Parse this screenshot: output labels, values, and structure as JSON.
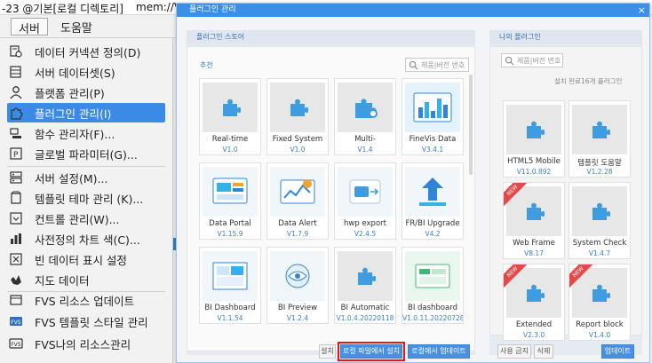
{
  "app": {
    "title_left": "-23 @기본[로컬 디렉토리]",
    "title_right": "mem://V"
  },
  "menubar": {
    "server": "서버",
    "help": "도움말"
  },
  "menu": {
    "items": [
      {
        "label": "데이터 커넥션 정의(D)",
        "icon": "data-connection-icon"
      },
      {
        "label": "서버 데이터셋(S)",
        "icon": "server-dataset-icon"
      },
      {
        "label": "플랫폼 관리(P)",
        "icon": "user-icon"
      },
      {
        "label": "플러그인 관리(I)",
        "icon": "puzzle-icon"
      },
      {
        "label": "함수 관리자(F)...",
        "icon": "function-icon"
      },
      {
        "label": "글로벌 파라미터(G)...",
        "icon": "parameter-icon"
      },
      {
        "label": "서버 설정(M)...",
        "icon": "server-settings-icon"
      },
      {
        "label": "템플릿 테마 관리 (K)...",
        "icon": "template-theme-icon"
      },
      {
        "label": "컨트롤 관리(W)...",
        "icon": "control-icon"
      },
      {
        "label": "사전정의 차트 색(C)...",
        "icon": "chart-color-icon"
      },
      {
        "label": "빈 데이터 표시 설정",
        "icon": "empty-data-icon"
      },
      {
        "label": "지도 데이터",
        "icon": "map-data-icon"
      },
      {
        "label": "FVS 리소스 업데이트",
        "icon": "fvs-update-icon"
      },
      {
        "label": "FVS 템플릿 스타일 관리",
        "icon": "fvs-template-icon"
      },
      {
        "label": "FVS나의 리소스관리",
        "icon": "fvs-resource-icon"
      }
    ]
  },
  "dialog": {
    "title": "플러그인 관리",
    "close": "×",
    "store": {
      "title": "플러그인 스토어",
      "section": "추천",
      "search_placeholder": "제품|버전 번호",
      "cards": [
        {
          "name": "Real-time",
          "version": "V1.0"
        },
        {
          "name": "Fixed System",
          "version": "V1.0"
        },
        {
          "name": "Multi-",
          "version": "V1.4"
        },
        {
          "name": "FineVis Data",
          "version": "V3.4.1"
        },
        {
          "name": "Data Portal",
          "version": "V1.15.9"
        },
        {
          "name": "Data Alert",
          "version": "V1.7.9"
        },
        {
          "name": "hwp export",
          "version": "V2.4.5"
        },
        {
          "name": "FR/BI Upgrade",
          "version": "V4.2"
        },
        {
          "name": "BI Dashboard",
          "version": "V1.1.54"
        },
        {
          "name": "BI Preview",
          "version": "V1.2.4"
        },
        {
          "name": "BI Automatic",
          "version": "V1.0.4.20220118"
        },
        {
          "name": "BI dashboard",
          "version": "V1.0.11.20220728"
        }
      ],
      "buttons": {
        "install": "설치",
        "install_local": "로컬 파일에서 설치",
        "update_local": "로컬에서 업데이트"
      }
    },
    "mine": {
      "title": "나의 플러그인",
      "search_placeholder": "제품|버전 번호",
      "count": "설치 완료16개 플러그인",
      "new_badge": "NEW",
      "cards": [
        {
          "name": "HTML5 Mobile",
          "version": "V11.0.892"
        },
        {
          "name": "템플릿 도움말",
          "version": "V1.2.28"
        },
        {
          "name": "Web Frame",
          "version": "V8.17"
        },
        {
          "name": "System Check",
          "version": "V1.4.7"
        },
        {
          "name": "Extended",
          "version": "V2.3.0"
        },
        {
          "name": "Report block",
          "version": "V1.4.0"
        }
      ],
      "buttons": {
        "disable": "사용 금지",
        "delete": "삭제",
        "update": "업데이트"
      }
    }
  },
  "colors": {
    "accent": "#3c8fe6",
    "menu_hover": "#3b8ae6",
    "version_text": "#3a7fcc",
    "highlight_box": "#e11111",
    "new_badge": "#e54848"
  }
}
